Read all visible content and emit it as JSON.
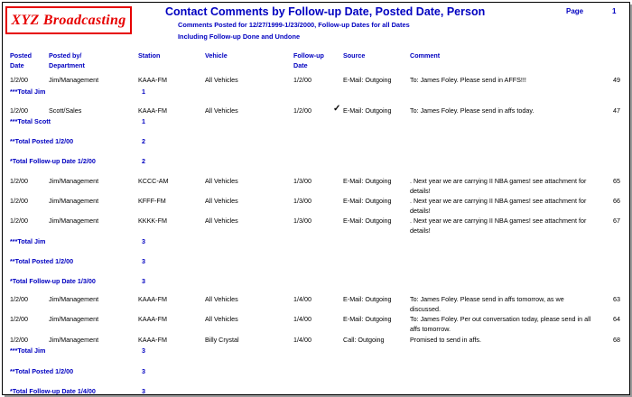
{
  "header": {
    "logo": "XYZ Broadcasting",
    "title": "Contact Comments by Follow-up Date, Posted Date, Person",
    "subtitle_line1": "Comments Posted for 12/27/1999-1/23/2000,  Follow-up Dates for all Dates",
    "subtitle_line2": "Including Follow-up Done and Undone",
    "page_label": "Page",
    "page_number": "1"
  },
  "columns": {
    "posted_date_1": "Posted",
    "posted_date_2": "Date",
    "posted_by_1": "Posted by/",
    "posted_by_2": "Department",
    "station": "Station",
    "vehicle": "Vehicle",
    "followup_1": "Follow-up",
    "followup_2": "Date",
    "source": "Source",
    "comment": "Comment"
  },
  "rows": [
    {
      "date": "1/2/00",
      "by": "Jim/Management",
      "station": "KAAA-FM",
      "vehicle": "All Vehicles",
      "followup": "1/2/00",
      "source": "E-Mail: Outgoing",
      "comment": "To: James Foley. Please send in AFFS!!!",
      "num": "49"
    },
    {
      "date": "1/2/00",
      "by": "Scott/Sales",
      "station": "KAAA-FM",
      "vehicle": "All Vehicles",
      "followup": "1/2/00",
      "source": "E-Mail: Outgoing",
      "comment": "To: James Foley. Please send in affs today.",
      "num": "47"
    },
    {
      "date": "1/2/00",
      "by": "Jim/Management",
      "station": "KCCC-AM",
      "vehicle": "All Vehicles",
      "followup": "1/3/00",
      "source": "E-Mail: Outgoing",
      "comment": ". Next year we are carrying II NBA games!   see attachment for details!",
      "num": "65"
    },
    {
      "date": "1/2/00",
      "by": "Jim/Management",
      "station": "KFFF-FM",
      "vehicle": "All Vehicles",
      "followup": "1/3/00",
      "source": "E-Mail: Outgoing",
      "comment": ". Next year we are carrying II NBA games!   see attachment for details!",
      "num": "66"
    },
    {
      "date": "1/2/00",
      "by": "Jim/Management",
      "station": "KKKK-FM",
      "vehicle": "All Vehicles",
      "followup": "1/3/00",
      "source": "E-Mail: Outgoing",
      "comment": ". Next year we are carrying II NBA games!   see attachment for details!",
      "num": "67"
    },
    {
      "date": "1/2/00",
      "by": "Jim/Management",
      "station": "KAAA-FM",
      "vehicle": "All Vehicles",
      "followup": "1/4/00",
      "source": "E-Mail: Outgoing",
      "comment": "To: James Foley. Please send in affs tomorrow, as we discussed.",
      "num": "63"
    },
    {
      "date": "1/2/00",
      "by": "Jim/Management",
      "station": "KAAA-FM",
      "vehicle": "All Vehicles",
      "followup": "1/4/00",
      "source": "E-Mail: Outgoing",
      "comment": "To: James Foley. Per out conversation today, please send in all affs tomorrow.",
      "num": "64"
    },
    {
      "date": "1/2/00",
      "by": "Jim/Management",
      "station": "KAAA-FM",
      "vehicle": "Billy Crystal",
      "followup": "1/4/00",
      "source": "Call: Outgoing",
      "comment": "Promised to send in affs.",
      "num": "68"
    }
  ],
  "check_mark": "✓",
  "totals": [
    {
      "label": "***Total Jim",
      "value": "1"
    },
    {
      "label": "***Total Scott",
      "value": "1"
    },
    {
      "label": "**Total Posted 1/2/00",
      "value": "2"
    },
    {
      "label": "*Total Follow-up Date 1/2/00",
      "value": "2"
    },
    {
      "label": "***Total Jim",
      "value": "3"
    },
    {
      "label": "**Total Posted 1/2/00",
      "value": "3"
    },
    {
      "label": "*Total Follow-up Date 1/3/00",
      "value": "3"
    },
    {
      "label": "***Total Jim",
      "value": "3"
    },
    {
      "label": "**Total Posted 1/2/00",
      "value": "3"
    },
    {
      "label": "*Total Follow-up Date 1/4/00",
      "value": "3"
    }
  ],
  "colors": {
    "accent": "#0000c0",
    "logo": "#e60000"
  }
}
